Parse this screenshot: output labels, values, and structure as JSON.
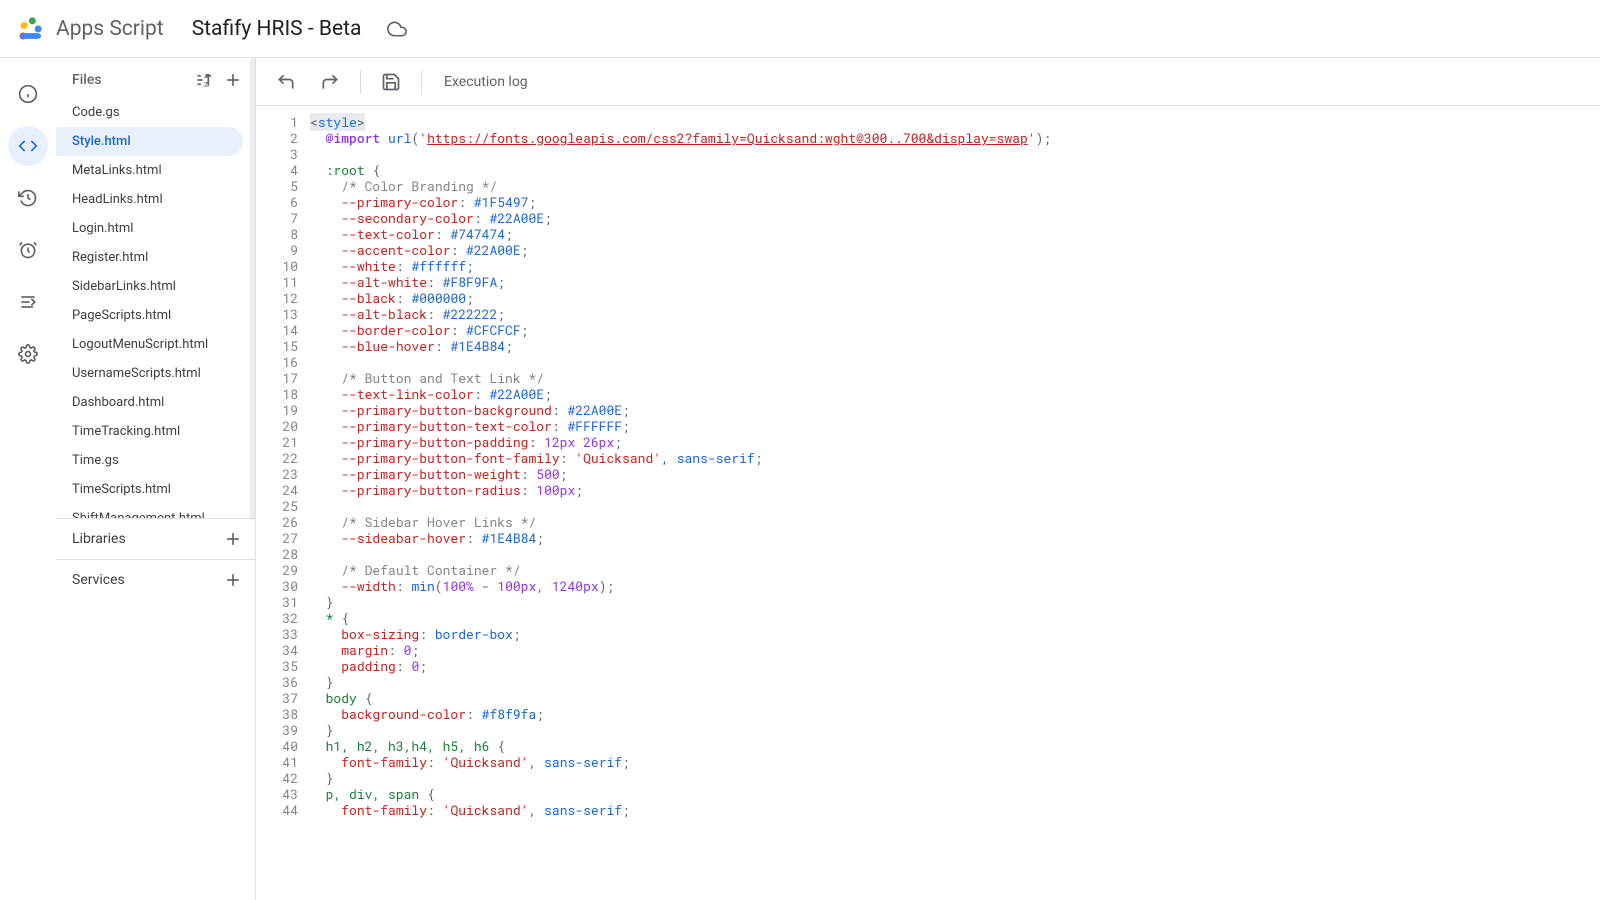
{
  "header": {
    "product": "Apps Script",
    "project": "Stafify HRIS - Beta"
  },
  "sidebar": {
    "files_label": "Files",
    "libraries_label": "Libraries",
    "services_label": "Services",
    "files": [
      {
        "name": "Code.gs",
        "selected": false
      },
      {
        "name": "Style.html",
        "selected": true
      },
      {
        "name": "MetaLinks.html",
        "selected": false
      },
      {
        "name": "HeadLinks.html",
        "selected": false
      },
      {
        "name": "Login.html",
        "selected": false
      },
      {
        "name": "Register.html",
        "selected": false
      },
      {
        "name": "SidebarLinks.html",
        "selected": false
      },
      {
        "name": "PageScripts.html",
        "selected": false
      },
      {
        "name": "LogoutMenuScript.html",
        "selected": false
      },
      {
        "name": "UsernameScripts.html",
        "selected": false
      },
      {
        "name": "Dashboard.html",
        "selected": false
      },
      {
        "name": "TimeTracking.html",
        "selected": false
      },
      {
        "name": "Time.gs",
        "selected": false
      },
      {
        "name": "TimeScripts.html",
        "selected": false
      },
      {
        "name": "ShiftManagement.html",
        "selected": false
      }
    ]
  },
  "toolbar": {
    "execution_log": "Execution log"
  },
  "editor": {
    "lines": [
      {
        "n": 1,
        "segs": [
          {
            "t": "<",
            "c": "tok-punc"
          },
          {
            "t": "style",
            "c": "tok-tag"
          },
          {
            "t": ">",
            "c": "tok-punc"
          }
        ],
        "hl": true
      },
      {
        "n": 2,
        "segs": [
          {
            "t": "  ",
            "c": ""
          },
          {
            "t": "@import",
            "c": "tok-atrule"
          },
          {
            "t": " ",
            "c": ""
          },
          {
            "t": "url",
            "c": "tok-func"
          },
          {
            "t": "(",
            "c": "tok-punc"
          },
          {
            "t": "'",
            "c": "tok-str"
          },
          {
            "t": "https://fonts.googleapis.com/css2?family=Quicksand:wght@300..700&display=swap",
            "c": "tok-link"
          },
          {
            "t": "'",
            "c": "tok-str"
          },
          {
            "t": ");",
            "c": "tok-punc"
          }
        ]
      },
      {
        "n": 3,
        "segs": []
      },
      {
        "n": 4,
        "segs": [
          {
            "t": "  ",
            "c": ""
          },
          {
            "t": ":root",
            "c": "tok-sel"
          },
          {
            "t": " {",
            "c": "tok-punc"
          }
        ]
      },
      {
        "n": 5,
        "segs": [
          {
            "t": "    ",
            "c": ""
          },
          {
            "t": "/* Color Branding */",
            "c": "tok-comment"
          }
        ]
      },
      {
        "n": 6,
        "segs": [
          {
            "t": "    ",
            "c": ""
          },
          {
            "t": "--primary-color",
            "c": "tok-prop"
          },
          {
            "t": ": ",
            "c": "tok-punc"
          },
          {
            "t": "#1F5497",
            "c": "tok-hex"
          },
          {
            "t": ";",
            "c": "tok-punc"
          }
        ]
      },
      {
        "n": 7,
        "segs": [
          {
            "t": "    ",
            "c": ""
          },
          {
            "t": "--secondary-color",
            "c": "tok-prop"
          },
          {
            "t": ": ",
            "c": "tok-punc"
          },
          {
            "t": "#22A00E",
            "c": "tok-hex"
          },
          {
            "t": ";",
            "c": "tok-punc"
          }
        ]
      },
      {
        "n": 8,
        "segs": [
          {
            "t": "    ",
            "c": ""
          },
          {
            "t": "--text-color",
            "c": "tok-prop"
          },
          {
            "t": ": ",
            "c": "tok-punc"
          },
          {
            "t": "#747474",
            "c": "tok-hex"
          },
          {
            "t": ";",
            "c": "tok-punc"
          }
        ]
      },
      {
        "n": 9,
        "segs": [
          {
            "t": "    ",
            "c": ""
          },
          {
            "t": "--accent-color",
            "c": "tok-prop"
          },
          {
            "t": ": ",
            "c": "tok-punc"
          },
          {
            "t": "#22A00E",
            "c": "tok-hex"
          },
          {
            "t": ";",
            "c": "tok-punc"
          }
        ]
      },
      {
        "n": 10,
        "segs": [
          {
            "t": "    ",
            "c": ""
          },
          {
            "t": "--white",
            "c": "tok-prop"
          },
          {
            "t": ": ",
            "c": "tok-punc"
          },
          {
            "t": "#ffffff",
            "c": "tok-hex"
          },
          {
            "t": ";",
            "c": "tok-punc"
          }
        ]
      },
      {
        "n": 11,
        "segs": [
          {
            "t": "    ",
            "c": ""
          },
          {
            "t": "--alt-white",
            "c": "tok-prop"
          },
          {
            "t": ": ",
            "c": "tok-punc"
          },
          {
            "t": "#F8F9FA",
            "c": "tok-hex"
          },
          {
            "t": ";",
            "c": "tok-punc"
          }
        ]
      },
      {
        "n": 12,
        "segs": [
          {
            "t": "    ",
            "c": ""
          },
          {
            "t": "--black",
            "c": "tok-prop"
          },
          {
            "t": ": ",
            "c": "tok-punc"
          },
          {
            "t": "#000000",
            "c": "tok-hex"
          },
          {
            "t": ";",
            "c": "tok-punc"
          }
        ]
      },
      {
        "n": 13,
        "segs": [
          {
            "t": "    ",
            "c": ""
          },
          {
            "t": "--alt-black",
            "c": "tok-prop"
          },
          {
            "t": ": ",
            "c": "tok-punc"
          },
          {
            "t": "#222222",
            "c": "tok-hex"
          },
          {
            "t": ";",
            "c": "tok-punc"
          }
        ]
      },
      {
        "n": 14,
        "segs": [
          {
            "t": "    ",
            "c": ""
          },
          {
            "t": "--border-color",
            "c": "tok-prop"
          },
          {
            "t": ": ",
            "c": "tok-punc"
          },
          {
            "t": "#CFCFCF",
            "c": "tok-hex"
          },
          {
            "t": ";",
            "c": "tok-punc"
          }
        ]
      },
      {
        "n": 15,
        "segs": [
          {
            "t": "    ",
            "c": ""
          },
          {
            "t": "--blue-hover",
            "c": "tok-prop"
          },
          {
            "t": ": ",
            "c": "tok-punc"
          },
          {
            "t": "#1E4B84",
            "c": "tok-hex"
          },
          {
            "t": ";",
            "c": "tok-punc"
          }
        ]
      },
      {
        "n": 16,
        "segs": []
      },
      {
        "n": 17,
        "segs": [
          {
            "t": "    ",
            "c": ""
          },
          {
            "t": "/* Button and Text Link */",
            "c": "tok-comment"
          }
        ]
      },
      {
        "n": 18,
        "segs": [
          {
            "t": "    ",
            "c": ""
          },
          {
            "t": "--text-link-color",
            "c": "tok-prop"
          },
          {
            "t": ": ",
            "c": "tok-punc"
          },
          {
            "t": "#22A00E",
            "c": "tok-hex"
          },
          {
            "t": ";",
            "c": "tok-punc"
          }
        ]
      },
      {
        "n": 19,
        "segs": [
          {
            "t": "    ",
            "c": ""
          },
          {
            "t": "--primary-button-background",
            "c": "tok-prop"
          },
          {
            "t": ": ",
            "c": "tok-punc"
          },
          {
            "t": "#22A00E",
            "c": "tok-hex"
          },
          {
            "t": ";",
            "c": "tok-punc"
          }
        ]
      },
      {
        "n": 20,
        "segs": [
          {
            "t": "    ",
            "c": ""
          },
          {
            "t": "--primary-button-text-color",
            "c": "tok-prop"
          },
          {
            "t": ": ",
            "c": "tok-punc"
          },
          {
            "t": "#FFFFFF",
            "c": "tok-hex"
          },
          {
            "t": ";",
            "c": "tok-punc"
          }
        ]
      },
      {
        "n": 21,
        "segs": [
          {
            "t": "    ",
            "c": ""
          },
          {
            "t": "--primary-button-padding",
            "c": "tok-prop"
          },
          {
            "t": ": ",
            "c": "tok-punc"
          },
          {
            "t": "12px 26px",
            "c": "tok-num"
          },
          {
            "t": ";",
            "c": "tok-punc"
          }
        ]
      },
      {
        "n": 22,
        "segs": [
          {
            "t": "    ",
            "c": ""
          },
          {
            "t": "--primary-button-font-family",
            "c": "tok-prop"
          },
          {
            "t": ": ",
            "c": "tok-punc"
          },
          {
            "t": "'Quicksand'",
            "c": "tok-str"
          },
          {
            "t": ", sans-serif",
            "c": "tok-val"
          },
          {
            "t": ";",
            "c": "tok-punc"
          }
        ]
      },
      {
        "n": 23,
        "segs": [
          {
            "t": "    ",
            "c": ""
          },
          {
            "t": "--primary-button-weight",
            "c": "tok-prop"
          },
          {
            "t": ": ",
            "c": "tok-punc"
          },
          {
            "t": "500",
            "c": "tok-num"
          },
          {
            "t": ";",
            "c": "tok-punc"
          }
        ]
      },
      {
        "n": 24,
        "segs": [
          {
            "t": "    ",
            "c": ""
          },
          {
            "t": "--primary-button-radius",
            "c": "tok-prop"
          },
          {
            "t": ": ",
            "c": "tok-punc"
          },
          {
            "t": "100px",
            "c": "tok-num"
          },
          {
            "t": ";",
            "c": "tok-punc"
          }
        ]
      },
      {
        "n": 25,
        "segs": []
      },
      {
        "n": 26,
        "segs": [
          {
            "t": "    ",
            "c": ""
          },
          {
            "t": "/* Sidebar Hover Links */",
            "c": "tok-comment"
          }
        ]
      },
      {
        "n": 27,
        "segs": [
          {
            "t": "    ",
            "c": ""
          },
          {
            "t": "--sideabar-hover",
            "c": "tok-prop"
          },
          {
            "t": ": ",
            "c": "tok-punc"
          },
          {
            "t": "#1E4B84",
            "c": "tok-hex"
          },
          {
            "t": ";",
            "c": "tok-punc"
          }
        ]
      },
      {
        "n": 28,
        "segs": []
      },
      {
        "n": 29,
        "segs": [
          {
            "t": "    ",
            "c": ""
          },
          {
            "t": "/* Default Container */",
            "c": "tok-comment"
          }
        ]
      },
      {
        "n": 30,
        "segs": [
          {
            "t": "    ",
            "c": ""
          },
          {
            "t": "--width",
            "c": "tok-prop"
          },
          {
            "t": ": ",
            "c": "tok-punc"
          },
          {
            "t": "min",
            "c": "tok-func"
          },
          {
            "t": "(",
            "c": "tok-punc"
          },
          {
            "t": "100% - 100px, 1240px",
            "c": "tok-num"
          },
          {
            "t": ");",
            "c": "tok-punc"
          }
        ]
      },
      {
        "n": 31,
        "segs": [
          {
            "t": "  }",
            "c": "tok-punc"
          }
        ]
      },
      {
        "n": 32,
        "segs": [
          {
            "t": "  ",
            "c": ""
          },
          {
            "t": "*",
            "c": "tok-sel"
          },
          {
            "t": " {",
            "c": "tok-punc"
          }
        ]
      },
      {
        "n": 33,
        "segs": [
          {
            "t": "    ",
            "c": ""
          },
          {
            "t": "box-sizing",
            "c": "tok-prop"
          },
          {
            "t": ": ",
            "c": "tok-punc"
          },
          {
            "t": "border-box",
            "c": "tok-val"
          },
          {
            "t": ";",
            "c": "tok-punc"
          }
        ]
      },
      {
        "n": 34,
        "segs": [
          {
            "t": "    ",
            "c": ""
          },
          {
            "t": "margin",
            "c": "tok-prop"
          },
          {
            "t": ": ",
            "c": "tok-punc"
          },
          {
            "t": "0",
            "c": "tok-num"
          },
          {
            "t": ";",
            "c": "tok-punc"
          }
        ]
      },
      {
        "n": 35,
        "segs": [
          {
            "t": "    ",
            "c": ""
          },
          {
            "t": "padding",
            "c": "tok-prop"
          },
          {
            "t": ": ",
            "c": "tok-punc"
          },
          {
            "t": "0",
            "c": "tok-num"
          },
          {
            "t": ";",
            "c": "tok-punc"
          }
        ]
      },
      {
        "n": 36,
        "segs": [
          {
            "t": "  }",
            "c": "tok-punc"
          }
        ]
      },
      {
        "n": 37,
        "segs": [
          {
            "t": "  ",
            "c": ""
          },
          {
            "t": "body",
            "c": "tok-sel"
          },
          {
            "t": " {",
            "c": "tok-punc"
          }
        ]
      },
      {
        "n": 38,
        "segs": [
          {
            "t": "    ",
            "c": ""
          },
          {
            "t": "background-color",
            "c": "tok-prop"
          },
          {
            "t": ": ",
            "c": "tok-punc"
          },
          {
            "t": "#f8f9fa",
            "c": "tok-hex"
          },
          {
            "t": ";",
            "c": "tok-punc"
          }
        ]
      },
      {
        "n": 39,
        "segs": [
          {
            "t": "  }",
            "c": "tok-punc"
          }
        ]
      },
      {
        "n": 40,
        "segs": [
          {
            "t": "  ",
            "c": ""
          },
          {
            "t": "h1, h2, h3,h4, h5, h6",
            "c": "tok-sel"
          },
          {
            "t": " {",
            "c": "tok-punc"
          }
        ]
      },
      {
        "n": 41,
        "segs": [
          {
            "t": "    ",
            "c": ""
          },
          {
            "t": "font-family",
            "c": "tok-prop"
          },
          {
            "t": ": ",
            "c": "tok-punc"
          },
          {
            "t": "'Quicksand'",
            "c": "tok-str"
          },
          {
            "t": ", sans-serif",
            "c": "tok-val"
          },
          {
            "t": ";",
            "c": "tok-punc"
          }
        ]
      },
      {
        "n": 42,
        "segs": [
          {
            "t": "  }",
            "c": "tok-punc"
          }
        ]
      },
      {
        "n": 43,
        "segs": [
          {
            "t": "  ",
            "c": ""
          },
          {
            "t": "p, div, span",
            "c": "tok-sel"
          },
          {
            "t": " {",
            "c": "tok-punc"
          }
        ]
      },
      {
        "n": 44,
        "segs": [
          {
            "t": "    ",
            "c": ""
          },
          {
            "t": "font-family",
            "c": "tok-prop"
          },
          {
            "t": ": ",
            "c": "tok-punc"
          },
          {
            "t": "'Quicksand'",
            "c": "tok-str"
          },
          {
            "t": ", sans-serif",
            "c": "tok-val"
          },
          {
            "t": ";",
            "c": "tok-punc"
          }
        ]
      }
    ]
  }
}
